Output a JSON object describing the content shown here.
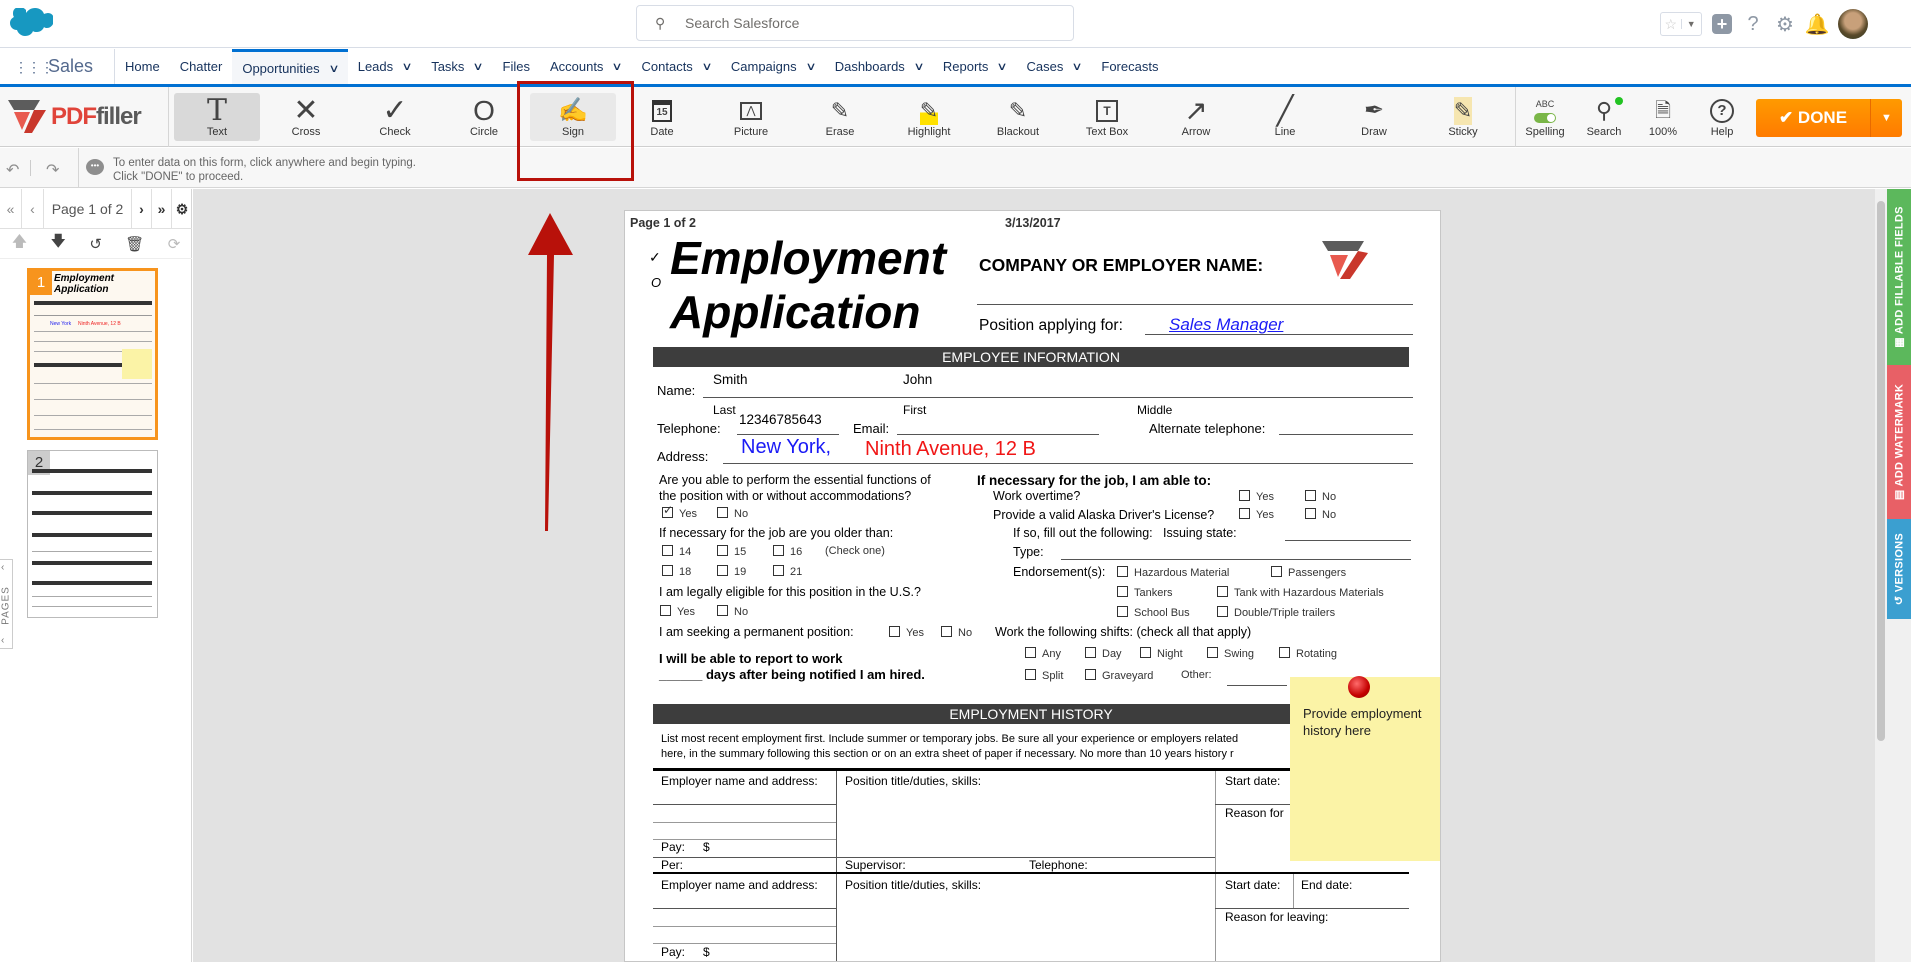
{
  "header": {
    "search_placeholder": "Search Salesforce",
    "icons": [
      "favorites-star-icon",
      "add-icon",
      "help-icon",
      "setup-gear-icon",
      "notifications-bell-icon",
      "user-avatar"
    ]
  },
  "nav": {
    "app_name": "Sales",
    "tabs": [
      {
        "label": "Home",
        "dropdown": false
      },
      {
        "label": "Chatter",
        "dropdown": false
      },
      {
        "label": "Opportunities",
        "dropdown": true,
        "active": true
      },
      {
        "label": "Leads",
        "dropdown": true
      },
      {
        "label": "Tasks",
        "dropdown": true
      },
      {
        "label": "Files",
        "dropdown": false
      },
      {
        "label": "Accounts",
        "dropdown": true
      },
      {
        "label": "Contacts",
        "dropdown": true
      },
      {
        "label": "Campaigns",
        "dropdown": true
      },
      {
        "label": "Dashboards",
        "dropdown": true
      },
      {
        "label": "Reports",
        "dropdown": true
      },
      {
        "label": "Cases",
        "dropdown": true
      },
      {
        "label": "Forecasts",
        "dropdown": false
      }
    ]
  },
  "toolbar": {
    "brand": {
      "pdf": "PDF",
      "filler": "filler"
    },
    "tools": [
      {
        "label": "Text",
        "icon": "T",
        "name": "text",
        "selected": true
      },
      {
        "label": "Cross",
        "icon": "✕",
        "name": "cross"
      },
      {
        "label": "Check",
        "icon": "✓",
        "name": "check"
      },
      {
        "label": "Circle",
        "icon": "O",
        "name": "circle"
      },
      {
        "label": "Sign",
        "icon": "✍",
        "name": "sign",
        "highlighted": true
      },
      {
        "label": "Date",
        "icon": "📅",
        "name": "date"
      },
      {
        "label": "Picture",
        "icon": "🖼",
        "name": "picture"
      },
      {
        "label": "Erase",
        "icon": "⌫",
        "name": "erase"
      },
      {
        "label": "Highlight",
        "icon": "🖍",
        "name": "highlight"
      },
      {
        "label": "Blackout",
        "icon": "▇",
        "name": "blackout"
      },
      {
        "label": "Text Box",
        "icon": "[T]",
        "name": "text-box"
      },
      {
        "label": "Arrow",
        "icon": "↗",
        "name": "arrow"
      },
      {
        "label": "Line",
        "icon": "╱",
        "name": "line"
      },
      {
        "label": "Draw",
        "icon": "✎",
        "name": "draw"
      },
      {
        "label": "Sticky",
        "icon": "📝",
        "name": "sticky"
      }
    ],
    "right_tools": [
      {
        "label": "Spelling",
        "top": "ABC",
        "name": "spelling",
        "toggle_on": true
      },
      {
        "label": "Search",
        "name": "search"
      },
      {
        "label": "100%",
        "name": "zoom"
      },
      {
        "label": "Help",
        "name": "help"
      }
    ],
    "done_label": "DONE"
  },
  "hint": {
    "line1": "To enter data on this form, click anywhere and begin typing.",
    "line2": "Click \"DONE\" to proceed."
  },
  "pages_panel": {
    "page_indicator": "Page 1 of 2",
    "current_page": 1,
    "total_pages": 2,
    "thumbnails": [
      "1",
      "2"
    ],
    "tab_label": "PAGES"
  },
  "right_tabs": {
    "fillable": "ADD FILLABLE FIELDS",
    "watermark": "ADD WATERMARK",
    "versions": "VERSIONS",
    "colors": {
      "fillable": "#5cb85c",
      "watermark": "#e86066",
      "versions": "#3b9fd0"
    }
  },
  "document": {
    "page_label": "Page 1 of 2",
    "date": "3/13/2017",
    "title_line1": "Employment",
    "title_line2": "Application",
    "company_label": "COMPANY OR EMPLOYER NAME:",
    "position_label": "Position applying for:",
    "position_value": "Sales Manager",
    "section_employee": "EMPLOYEE INFORMATION",
    "name_label": "Name:",
    "last_name": "Smith",
    "first_name": "John",
    "last_caption": "Last",
    "first_caption": "First",
    "middle_caption": "Middle",
    "telephone_label": "Telephone:",
    "telephone_value": "12346785643",
    "email_label": "Email:",
    "alt_phone_label": "Alternate telephone:",
    "address_label": "Address:",
    "address_city": "New York,",
    "address_street": "Ninth Avenue, 12 B",
    "q_accommodations": "Are you able to perform the essential functions of",
    "q_accommodations2": "the position with or without accommodations?",
    "yes": "Yes",
    "no": "No",
    "q_older": "If necessary for the job are you older than:",
    "ages_row1": [
      "14",
      "15",
      "16"
    ],
    "check_one": "(Check one)",
    "ages_row2": [
      "18",
      "19",
      "21"
    ],
    "q_eligible": "I am legally eligible for this position in the U.S.?",
    "q_permanent": "I am seeking a permanent position:",
    "report_line1": "I will be able to report to work",
    "report_line2": "______ days after being notified I am hired.",
    "able_heading": "If necessary for the job, I am able to:",
    "q_overtime": "Work overtime?",
    "q_license": "Provide a valid Alaska Driver's License?",
    "if_so": "If so, fill out the following:",
    "issuing_state": "Issuing state:",
    "type_label": "Type:",
    "endorsements_label": "Endorsement(s):",
    "endorsements": [
      "Hazardous Material",
      "Passengers",
      "Tankers",
      "Tank with Hazardous Materials",
      "School Bus",
      "Double/Triple trailers"
    ],
    "shifts_label": "Work the following shifts: (check all that apply)",
    "shifts_row1": [
      "Any",
      "Day",
      "Night",
      "Swing",
      "Rotating"
    ],
    "shifts_row2": [
      "Split",
      "Graveyard"
    ],
    "other_label": "Other:",
    "section_history": "EMPLOYMENT HISTORY",
    "history_note1": "List most recent employment first. Include summer or temporary jobs. Be sure all your experience or employers related",
    "history_note2": "here, in the summary following this section or on an extra sheet of paper if necessary. No more than 10 years history r",
    "employer_label": "Employer name and address:",
    "position_duties_label": "Position title/duties, skills:",
    "start_date_label": "Start date:",
    "end_date_label": "End date:",
    "reason_label": "Reason for",
    "reason_full_label": "Reason for leaving:",
    "pay_label": "Pay:",
    "dollar": "$",
    "per_label": "Per:",
    "supervisor_label": "Supervisor:",
    "telephone_label2": "Telephone:"
  },
  "sticky_note": {
    "text": "Provide employment history here"
  },
  "annotation": {
    "highlighted_tool": "Sign",
    "arrow_color": "#b8110a"
  }
}
